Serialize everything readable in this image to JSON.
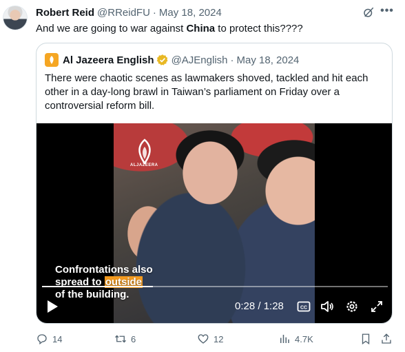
{
  "tweet": {
    "author_name": "Robert Reid",
    "handle": "@RReidFU",
    "separator": "·",
    "date": "May 18, 2024",
    "text_before": "And we are going to war against ",
    "text_bold": "China",
    "text_after": " to protect this????"
  },
  "quote": {
    "author_name": "Al Jazeera English",
    "handle": "@AJEnglish",
    "separator": "·",
    "date": "May 18, 2024",
    "text": "There were chaotic scenes as lawmakers shoved, tackled and hit each other in a day-long brawl in Taiwan’s parliament on Friday over a controversial reform bill."
  },
  "video": {
    "watermark": "ALJAZEERA",
    "caption_line1": "Confrontations also",
    "caption_line2_before": "spread to ",
    "caption_line2_highlight": "outside",
    "caption_line3": "of the building.",
    "time_display": "0:28 / 1:28",
    "progress_fraction": 0.32,
    "cc_label": "CC"
  },
  "actions": {
    "replies": "14",
    "reposts": "6",
    "likes": "12",
    "views": "4.7K"
  },
  "colors": {
    "text": "#0f1419",
    "secondary": "#536471",
    "border": "#cfd9de",
    "aj_orange": "#f5a623",
    "verified_gold": "#e8b824",
    "caption_highlight": "#f39a1f"
  },
  "icons": [
    "grok-icon",
    "more-icon",
    "verified-icon",
    "play-icon",
    "cc-icon",
    "volume-icon",
    "settings-icon",
    "fullscreen-icon",
    "reply-icon",
    "repost-icon",
    "like-icon",
    "views-icon",
    "bookmark-icon",
    "share-icon"
  ]
}
